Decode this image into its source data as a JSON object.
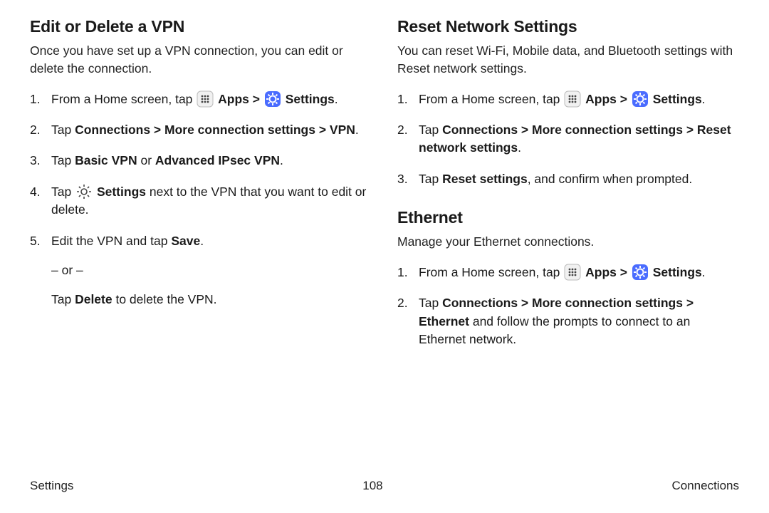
{
  "left": {
    "h": "Edit or Delete a VPN",
    "intro": "Once you have set up a VPN connection, you can edit or delete the connection.",
    "s1a": "From a Home screen, tap ",
    "apps": "Apps",
    "gt": " > ",
    "settings": "Settings",
    "dot": ".",
    "s2a": "Tap ",
    "s2b": "Connections > More connection settings > VPN",
    "s3a": "Tap ",
    "s3b": "Basic VPN",
    "s3c": " or ",
    "s3d": "Advanced IPsec VPN",
    "s4a": "Tap ",
    "s4b": "Settings",
    "s4c": " next to the VPN that you want to edit or delete.",
    "s5a": "Edit the VPN and tap ",
    "s5b": "Save",
    "s5or": "– or –",
    "s5d": "Tap ",
    "s5e": "Delete",
    "s5f": " to delete the VPN."
  },
  "right": {
    "h1": "Reset Network Settings",
    "intro1": "You can reset Wi-Fi, Mobile data, and Bluetooth settings with Reset network settings.",
    "r1a": "From a Home screen, tap ",
    "r2a": "Tap ",
    "r2b": "Connections > More connection settings > Reset network settings",
    "r3a": "Tap ",
    "r3b": "Reset settings",
    "r3c": ", and confirm when prompted.",
    "h2": "Ethernet",
    "intro2": "Manage your Ethernet connections.",
    "e2a": "Tap ",
    "e2b": "Connections > More connection settings > Ethernet",
    "e2c": " and follow the prompts to connect to an Ethernet network."
  },
  "footer": {
    "left": "Settings",
    "center": "108",
    "right": "Connections"
  }
}
